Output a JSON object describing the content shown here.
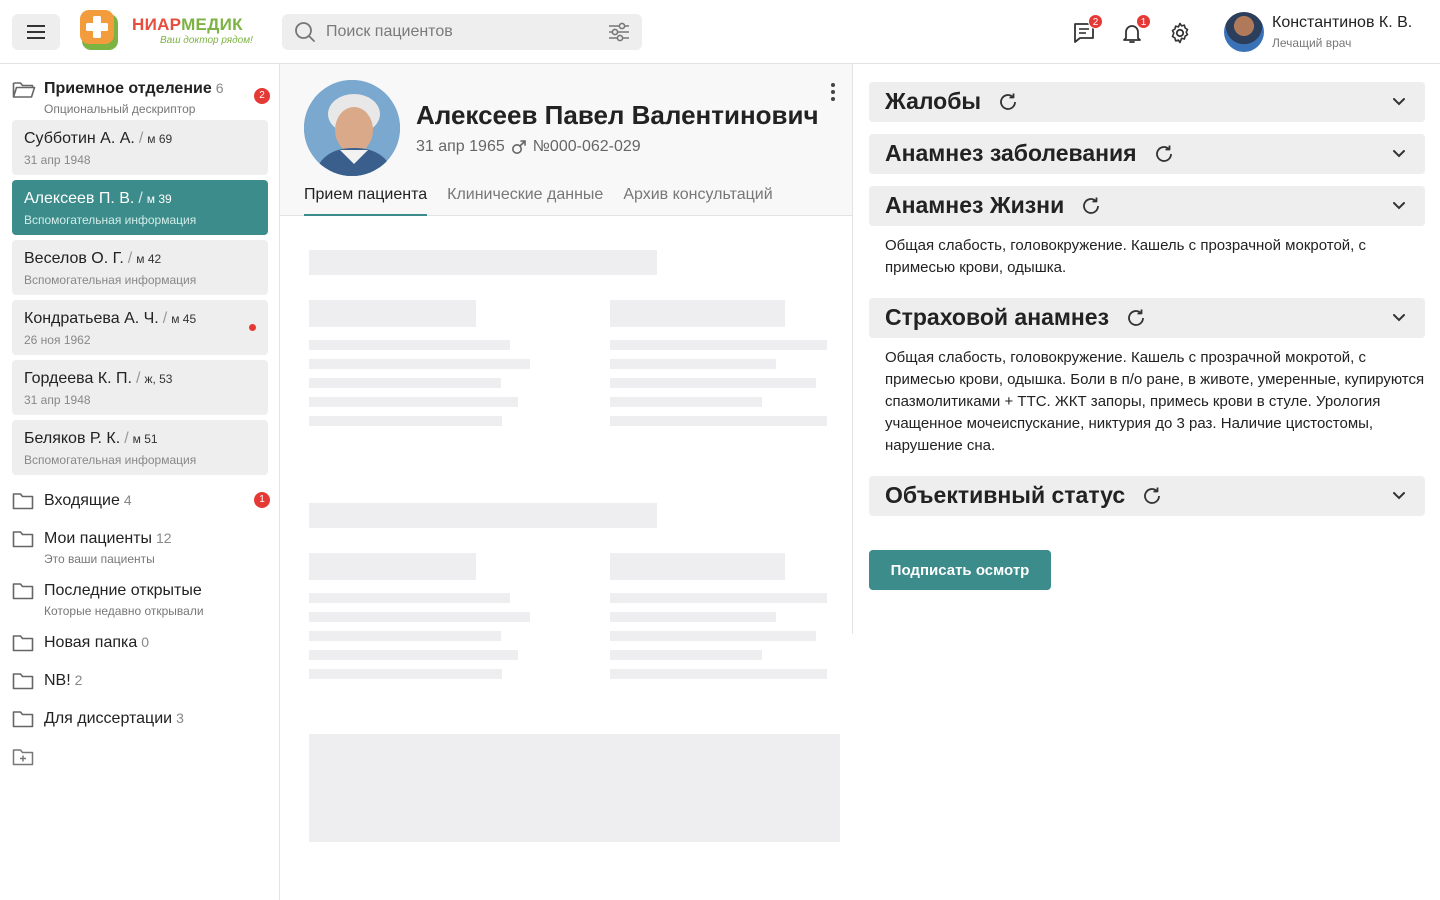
{
  "header": {
    "logo_name_part1": "НИАР",
    "logo_name_part2": "МЕДИК",
    "logo_tagline": "Ваш доктор рядом!",
    "search_placeholder": "Поиск пациентов",
    "messages_badge": "2",
    "notifications_badge": "1",
    "user_name": "Константинов К. В.",
    "user_role": "Лечащий врач"
  },
  "sidebar": {
    "reception": {
      "title": "Приемное отделение",
      "count": "6",
      "subtitle": "Опциональный дескриптор",
      "badge": "2"
    },
    "patients": [
      {
        "name": "Субботин А. А.",
        "meta": "м 69",
        "info": "31 апр 1948"
      },
      {
        "name": "Алексеев П. В.",
        "meta": "м 39",
        "info": "Вспомогательная информация"
      },
      {
        "name": "Веселов О. Г.",
        "meta": "м 42",
        "info": "Вспомогательная информация"
      },
      {
        "name": "Кондратьева А. Ч.",
        "meta": "м 45",
        "info": "26 ноя 1962"
      },
      {
        "name": "Гордеева К. П.",
        "meta": "ж, 53",
        "info": "31 апр 1948"
      },
      {
        "name": "Беляков Р. К.",
        "meta": "м 51",
        "info": "Вспомогательная информация"
      }
    ],
    "folders": [
      {
        "title": "Входящие",
        "count": "4",
        "subtitle": "",
        "badge": "1"
      },
      {
        "title": "Мои пациенты",
        "count": "12",
        "subtitle": "Это ваши пациенты"
      },
      {
        "title": "Последние открытые",
        "count": "",
        "subtitle": "Которые недавно открывали"
      },
      {
        "title": "Новая папка",
        "count": "0"
      },
      {
        "title": "NB!",
        "count": "2"
      },
      {
        "title": "Для диссертации",
        "count": "3"
      }
    ]
  },
  "patient": {
    "full_name": "Алексеев Павел Валентинович",
    "birth_date": "31 апр 1965",
    "record_number": "№000-062-029",
    "tabs": [
      "Прием пациента",
      "Клинические данные",
      "Архив консультаций"
    ]
  },
  "right_panel": {
    "sections": [
      {
        "title": "Жалобы"
      },
      {
        "title": "Анамнез заболевания"
      },
      {
        "title": "Анамнез Жизни",
        "text": "Общая слабость, головокружение. Кашель с прозрачной мокротой, с примесью крови, одышка."
      },
      {
        "title": "Страховой анамнез",
        "text": "Общая слабость, головокружение. Кашель с прозрачной мокротой, с примесью крови, одышка. Боли в п/о ране, в животе, умеренные, купируются спазмолитиками + ТТС. ЖКТ запоры, примесь крови в стуле. Урология учащенное мочеиспускание, никтурия до 3 раз. Наличие цистостомы, нарушение сна."
      },
      {
        "title": "Объективный статус"
      }
    ],
    "sign_button": "Подписать осмотр"
  },
  "colors": {
    "accent_teal": "#3b8c8a",
    "badge_red": "#e53935",
    "logo_orange": "#f39c3d",
    "logo_green": "#7cb342"
  }
}
